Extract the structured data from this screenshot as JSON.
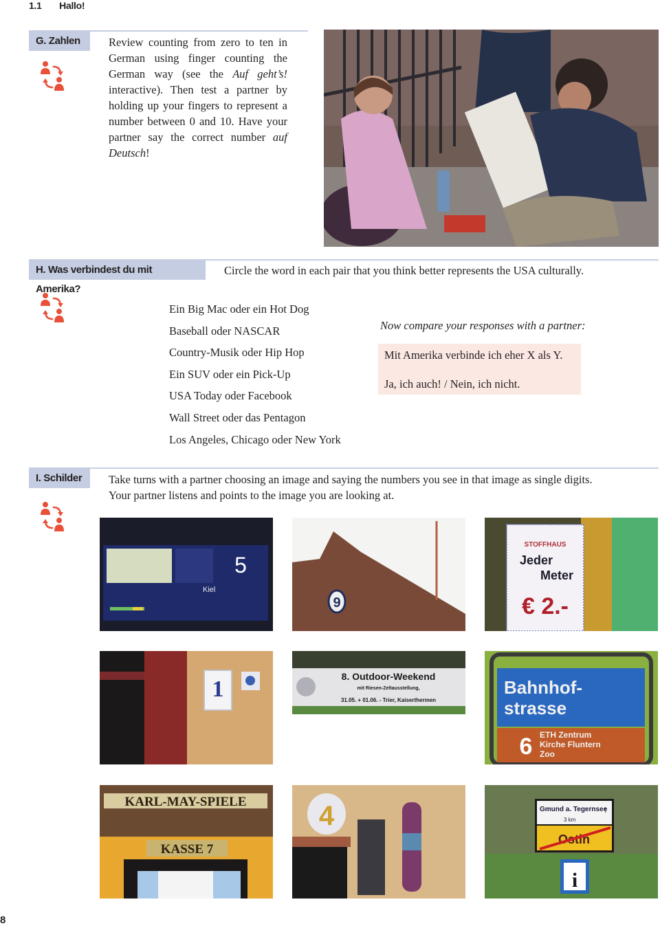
{
  "running_head": {
    "chapter": "1.1",
    "title": "Hallo!"
  },
  "sections": {
    "g": {
      "label": "G. Zahlen",
      "icon": "partner-exchange-icon",
      "text_parts": [
        "Review counting from zero to ten in German using finger counting the German way (see the ",
        "Auf geht’s!",
        " interactive). Then test a partner by holding up your fingers to represent a number between 0 and 10. Have your partner say the correct number ",
        "auf Deutsch",
        "!"
      ],
      "photo_alt": "Street artist sketching a portrait of a young girl in a pink coat"
    },
    "h": {
      "label": "H. Was verbindest du mit Amerika?",
      "instruction": "Circle the word in each pair that you think better represents the USA culturally.",
      "icon": "partner-exchange-icon",
      "pairs": [
        "Ein Big Mac oder ein Hot Dog",
        "Baseball oder NASCAR",
        "Country-Musik oder Hip Hop",
        "Ein SUV oder ein Pick-Up",
        "USA Today oder Facebook",
        "Wall Street oder das Pentagon",
        "Los Angeles, Chicago oder New York"
      ],
      "compare_prompt": "Now compare your responses with a partner:",
      "compare_lines": [
        "Mit Amerika verbinde ich eher X als Y.",
        "Ja, ich auch! / Nein, ich nicht."
      ]
    },
    "i": {
      "label": "I. Schilder",
      "icon": "partner-exchange-icon",
      "instruction_lines": [
        "Take turns with a partner choosing an image and saying the numbers you see in that image as single digits.",
        "Your partner listens and points to the image you are looking at."
      ],
      "images": [
        {
          "name": "train-departure-board",
          "texts": [
            "5",
            "Kiel"
          ]
        },
        {
          "name": "brick-gable-number",
          "texts": [
            "9"
          ]
        },
        {
          "name": "fabric-price-sign",
          "texts": [
            "STOFFHAUS",
            "Jeder",
            "Meter",
            "€ 2.-"
          ]
        },
        {
          "name": "house-number-plaque",
          "texts": [
            "1"
          ]
        },
        {
          "name": "outdoor-weekend-banner",
          "texts": [
            "8. Outdoor-Weekend",
            "mit Riesen-Zeltausstellung,",
            "31.05. + 01.06. - Trier, Kaiserthermen"
          ]
        },
        {
          "name": "tram-stop-sign",
          "texts": [
            "Bahnhof-",
            "strasse",
            "6",
            "ETH Zentrum",
            "Kirche Fluntern",
            "Zoo"
          ]
        },
        {
          "name": "ticket-booth-sign",
          "texts": [
            "KARL-MAY-SPIELE",
            "KASSE 7"
          ]
        },
        {
          "name": "hundertwasser-house-number",
          "texts": [
            "4"
          ]
        },
        {
          "name": "town-exit-sign",
          "texts": [
            "Gmund a. Tegernsee",
            "3 km",
            "Ostin",
            "i"
          ]
        }
      ]
    }
  },
  "colors": {
    "label_bg": "#c5cde2",
    "icon_red": "#e8503a",
    "compare_bg": "#fbe8e3"
  },
  "page_number": "8"
}
